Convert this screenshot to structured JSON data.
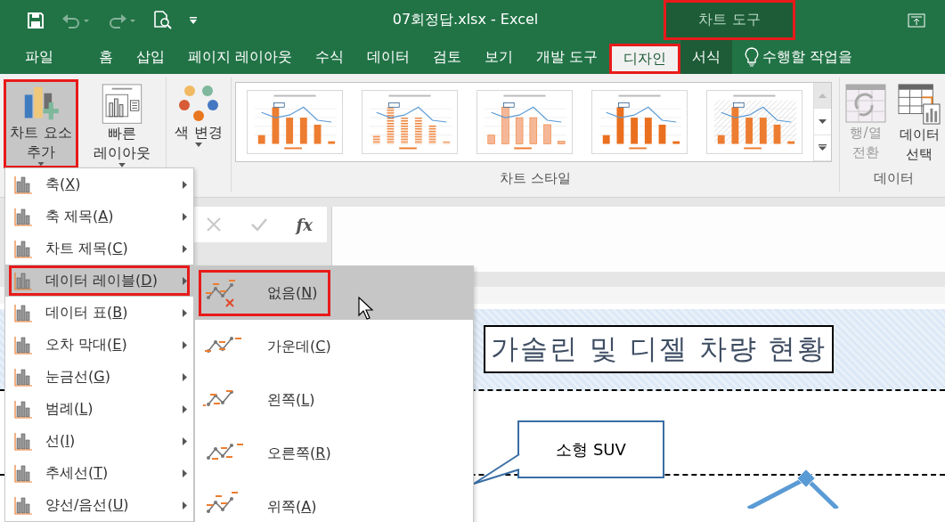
{
  "window": {
    "title": "07회정답.xlsx - Excel",
    "context_label": "차트 도구",
    "context_highlighted": true
  },
  "quick_access": [
    {
      "kind": "save",
      "disabled": false
    },
    {
      "kind": "undo",
      "disabled": true
    },
    {
      "kind": "redo",
      "disabled": true
    },
    {
      "kind": "preview",
      "disabled": false
    },
    {
      "kind": "customize",
      "disabled": false
    }
  ],
  "tabs": [
    {
      "label": "파일",
      "selected": false,
      "contextual": false,
      "highlighted": false
    },
    {
      "label": "홈",
      "selected": false,
      "contextual": false,
      "highlighted": false
    },
    {
      "label": "삽입",
      "selected": false,
      "contextual": false,
      "highlighted": false
    },
    {
      "label": "페이지 레이아웃",
      "selected": false,
      "contextual": false,
      "highlighted": false
    },
    {
      "label": "수식",
      "selected": false,
      "contextual": false,
      "highlighted": false
    },
    {
      "label": "데이터",
      "selected": false,
      "contextual": false,
      "highlighted": false
    },
    {
      "label": "검토",
      "selected": false,
      "contextual": false,
      "highlighted": false
    },
    {
      "label": "보기",
      "selected": false,
      "contextual": false,
      "highlighted": false
    },
    {
      "label": "개발 도구",
      "selected": false,
      "contextual": false,
      "highlighted": false
    },
    {
      "label": "디자인",
      "selected": true,
      "contextual": true,
      "highlighted": true
    },
    {
      "label": "서식",
      "selected": false,
      "contextual": true,
      "highlighted": false
    }
  ],
  "tell_me": {
    "text": "수행할 작업을"
  },
  "ribbon": {
    "chart_layouts": [
      {
        "kind": "add_element",
        "label": "차트 요소\n추가",
        "pressed": true,
        "highlighted": true
      },
      {
        "kind": "quick_layout",
        "label": "빠른\n레이아웃",
        "pressed": false,
        "highlighted": false
      }
    ],
    "change_colors": {
      "label": "색 변경"
    },
    "chart_styles": {
      "label": "차트 스타일",
      "thumbnails": [
        {
          "kind": "solid"
        },
        {
          "kind": "striped"
        },
        {
          "kind": "light"
        },
        {
          "kind": "gradient"
        },
        {
          "kind": "hatched"
        }
      ]
    },
    "data": {
      "label": "데이터",
      "buttons": [
        {
          "kind": "switch",
          "label": "행/열\n전환",
          "disabled": true
        },
        {
          "kind": "select",
          "label": "데이터\n선택",
          "disabled": false
        }
      ]
    }
  },
  "formula_bar": {
    "function_label": "fx"
  },
  "element_menu": {
    "items": [
      {
        "label": "축(X)",
        "selected": false,
        "highlighted": false
      },
      {
        "label": "축 제목(A)",
        "selected": false,
        "highlighted": false
      },
      {
        "label": "차트 제목(C)",
        "selected": false,
        "highlighted": false
      },
      {
        "label": "데이터 레이블(D)",
        "selected": true,
        "highlighted": true
      },
      {
        "label": "데이터 표(B)",
        "selected": false,
        "highlighted": false
      },
      {
        "label": "오차 막대(E)",
        "selected": false,
        "highlighted": false
      },
      {
        "label": "눈금선(G)",
        "selected": false,
        "highlighted": false
      },
      {
        "label": "범례(L)",
        "selected": false,
        "highlighted": false
      },
      {
        "label": "선(I)",
        "selected": false,
        "highlighted": false
      },
      {
        "label": "추세선(T)",
        "selected": false,
        "highlighted": false
      },
      {
        "label": "양선/음선(U)",
        "selected": false,
        "highlighted": false
      }
    ]
  },
  "label_submenu": {
    "items": [
      {
        "kind": "none",
        "label": "없음(N)",
        "selected": true,
        "highlighted": true
      },
      {
        "kind": "center",
        "label": "가운데(C)",
        "selected": false,
        "highlighted": false
      },
      {
        "kind": "left",
        "label": "왼쪽(L)",
        "selected": false,
        "highlighted": false
      },
      {
        "kind": "right",
        "label": "오른쪽(R)",
        "selected": false,
        "highlighted": false
      },
      {
        "kind": "above",
        "label": "위쪽(A)",
        "selected": false,
        "highlighted": false
      }
    ]
  },
  "chart": {
    "title": "가솔린 및 디젤 차량 현황",
    "callout": "소형 SUV"
  }
}
